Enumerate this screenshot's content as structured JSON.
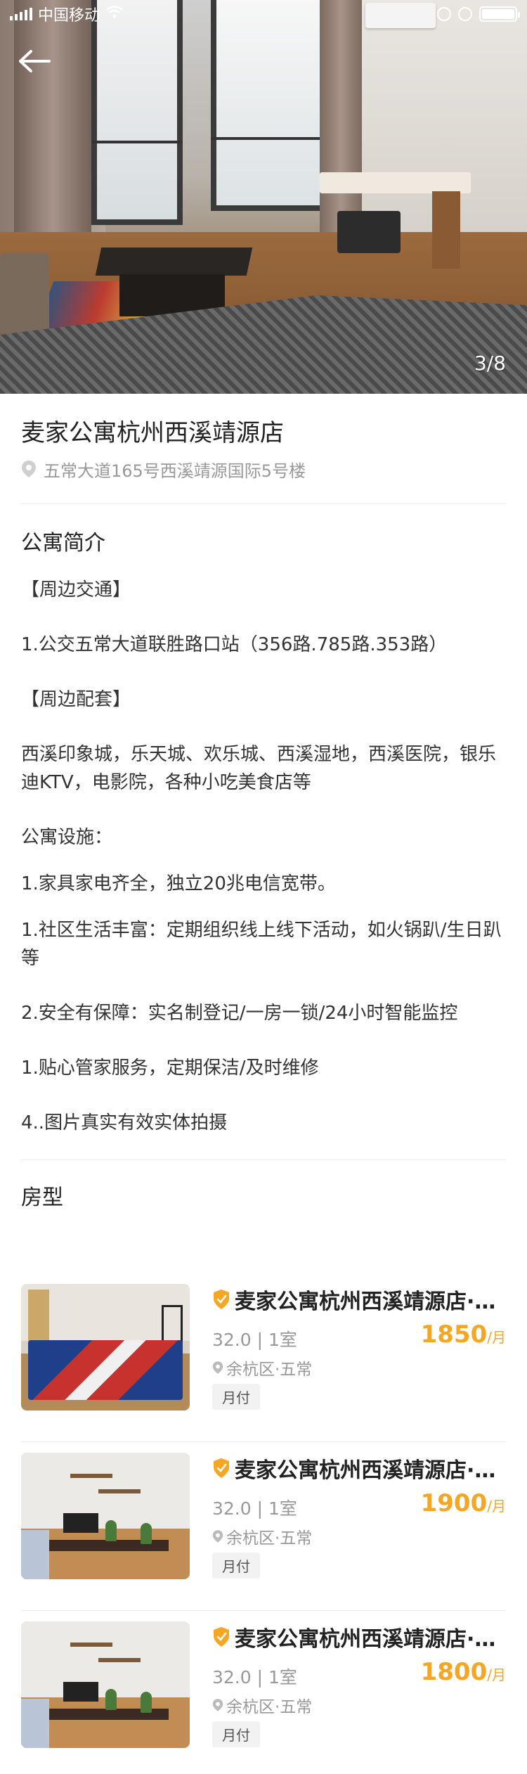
{
  "status": {
    "carrier": "中国移动",
    "wifi_icon": "wifi-icon",
    "icons": [
      "sync-icon",
      "alarm-icon",
      "battery-icon"
    ]
  },
  "hero": {
    "pager": "3/8",
    "back_icon": "back-arrow-icon"
  },
  "apartment": {
    "title": "麦家公寓杭州西溪靖源店",
    "address": "五常大道165号西溪靖源国际5号楼"
  },
  "intro": {
    "heading": "公寓简介",
    "lines": [
      "【周边交通】",
      "1.公交五常大道联胜路口站（356路.785路.353路）",
      "【周边配套】",
      "西溪印象城，乐天城、欢乐城、西溪湿地，西溪医院，银乐迪KTV，电影院，各种小吃美食店等",
      "公寓设施：",
      "1.家具家电齐全，独立20兆电信宽带。",
      "1.社区生活丰富：定期组织线上线下活动，如火锅趴/生日趴等",
      "2.安全有保障：实名制登记/一房一锁/24小时智能监控",
      "1.贴心管家服务，定期保洁/及时维修",
      "4..图片真实有效实体拍摄"
    ]
  },
  "rooms": {
    "heading": "房型",
    "items": [
      {
        "name": "麦家公寓杭州西溪靖源店·…",
        "meta": "32.0 | 1室",
        "location": "余杭区·五常",
        "price": "1850",
        "unit": "/月",
        "tag": "月付"
      },
      {
        "name": "麦家公寓杭州西溪靖源店·…",
        "meta": "32.0 | 1室",
        "location": "余杭区·五常",
        "price": "1900",
        "unit": "/月",
        "tag": "月付"
      },
      {
        "name": "麦家公寓杭州西溪靖源店·…",
        "meta": "32.0 | 1室",
        "location": "余杭区·五常",
        "price": "1800",
        "unit": "/月",
        "tag": "月付"
      }
    ]
  },
  "colors": {
    "accent_price": "#f5a623",
    "muted": "#999999",
    "divider": "#ececec",
    "badge": "#f5a623"
  }
}
